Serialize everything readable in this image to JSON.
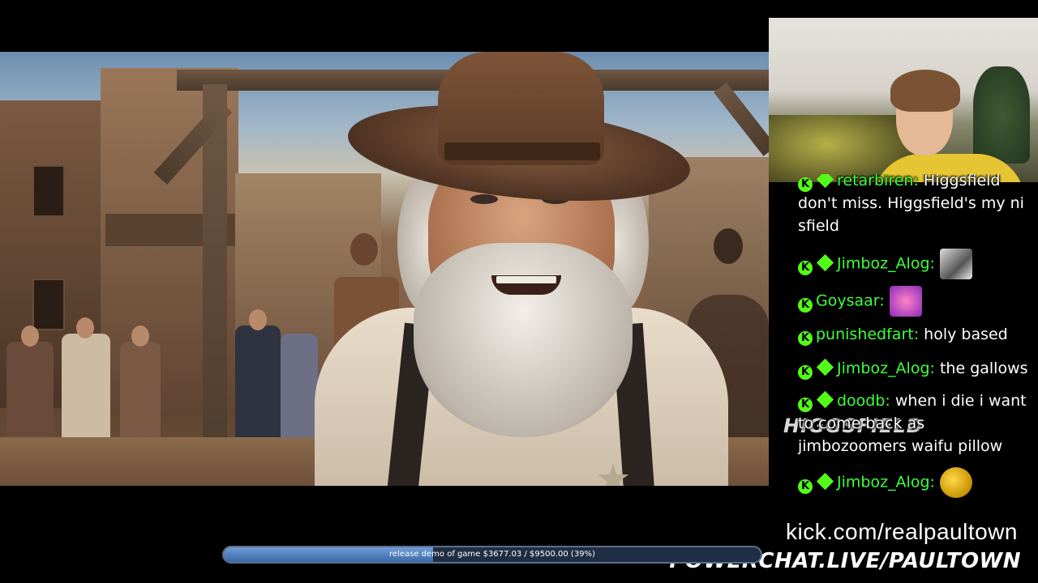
{
  "stream": {
    "kick_url": "kick.com/realpaultown",
    "powerchat_url": "POWERCHAT.LIVE/PAULTOWN",
    "watermark": "HIGGSFIELD"
  },
  "goal": {
    "label": "release demo of game $3677.03 / $9500.00 (39%)",
    "progress": 0.39,
    "fill_color": "#4f81c0"
  },
  "chat": {
    "messages": [
      {
        "user": "retarbiren:",
        "text": "Higgsfield don't miss. Higgsfield's my ni sfield",
        "badges": [
          "kick",
          "diamond"
        ],
        "emote": null
      },
      {
        "user": "Jimboz_Alog:",
        "text": "",
        "badges": [
          "kick",
          "diamond"
        ],
        "emote": "bw-anime-emote"
      },
      {
        "user": "Goysaar:",
        "text": "",
        "badges": [
          "kick"
        ],
        "emote": "pink-anime-emote"
      },
      {
        "user": "punishedfart:",
        "text": "holy based",
        "badges": [
          "kick"
        ],
        "emote": null
      },
      {
        "user": "Jimboz_Alog:",
        "text": "the gallows",
        "badges": [
          "kick",
          "diamond"
        ],
        "emote": null
      },
      {
        "user": "doodb:",
        "text": "when i die i want to come back as jimbozoomers waifu pillow",
        "badges": [
          "kick",
          "diamond"
        ],
        "emote": null
      },
      {
        "user": "Jimboz_Alog:",
        "text": "",
        "badges": [
          "kick",
          "diamond"
        ],
        "emote": "yellow-ball-emote"
      }
    ],
    "username_color": "#3cff3c",
    "badge_color": "#53fc18"
  }
}
